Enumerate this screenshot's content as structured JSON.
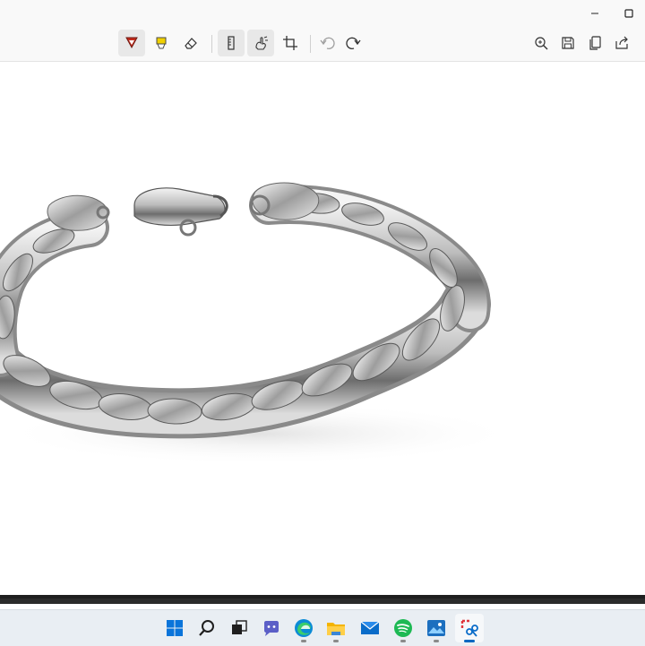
{
  "window": {
    "controls": {
      "minimize": "minimize-icon",
      "maximize": "maximize-icon"
    }
  },
  "toolbar": {
    "left_tools": [
      {
        "id": "ballpoint-pen",
        "icon": "pen-icon",
        "color": "#c42b1c",
        "active": true
      },
      {
        "id": "highlighter",
        "icon": "highlighter-icon",
        "color": "#f0d000",
        "active": false
      },
      {
        "id": "eraser",
        "icon": "eraser-icon",
        "active": false
      },
      {
        "id": "ruler",
        "icon": "ruler-icon",
        "active": true
      },
      {
        "id": "touch-writing",
        "icon": "touch-writing-icon",
        "active": true
      },
      {
        "id": "crop",
        "icon": "crop-icon",
        "active": false
      },
      {
        "id": "undo",
        "icon": "undo-icon",
        "enabled": false
      },
      {
        "id": "redo",
        "icon": "redo-icon",
        "enabled": true
      }
    ],
    "right_tools": [
      {
        "id": "zoom",
        "icon": "zoom-in-icon"
      },
      {
        "id": "save",
        "icon": "save-icon"
      },
      {
        "id": "copy",
        "icon": "copy-icon"
      },
      {
        "id": "share",
        "icon": "share-icon"
      }
    ],
    "accent": "#0067c0"
  },
  "canvas": {
    "image_subject": "silver-chain-bracelet"
  },
  "taskbar": {
    "items": [
      {
        "id": "start",
        "icon": "windows-start-icon",
        "running": false
      },
      {
        "id": "search",
        "icon": "search-icon",
        "running": false
      },
      {
        "id": "task-view",
        "icon": "task-view-icon",
        "running": false
      },
      {
        "id": "teams-chat",
        "icon": "chat-icon",
        "running": false
      },
      {
        "id": "edge",
        "icon": "edge-browser-icon",
        "running": true
      },
      {
        "id": "file-explorer",
        "icon": "folder-icon",
        "running": true
      },
      {
        "id": "mail",
        "icon": "mail-icon",
        "running": false
      },
      {
        "id": "spotify",
        "icon": "spotify-icon",
        "running": true
      },
      {
        "id": "photos",
        "icon": "photos-icon",
        "running": true
      },
      {
        "id": "snipping-tool",
        "icon": "snipping-tool-icon",
        "running": true,
        "active": true
      }
    ]
  }
}
